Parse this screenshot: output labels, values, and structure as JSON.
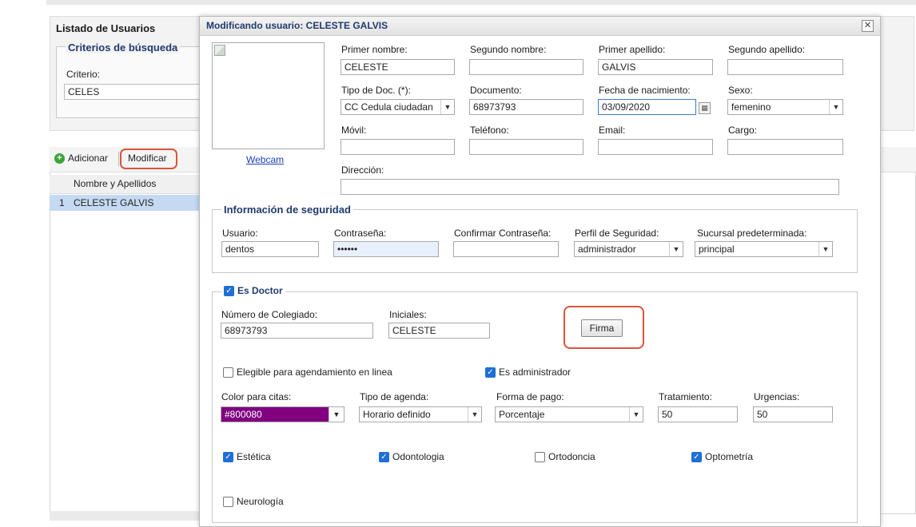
{
  "background": {
    "title": "Listado de Usuarios",
    "criteria_legend": "Criterios de búsqueda",
    "criteria_label": "Criterio:",
    "criteria_value": "CELES",
    "add_label": "Adicionar",
    "modify_label": "Modificar",
    "column_header": "Nombre y Apellidos",
    "rows": [
      {
        "num": "1",
        "name": "CELESTE GALVIS"
      }
    ]
  },
  "dialog": {
    "title": "Modificando usuario: CELESTE GALVIS",
    "close_icon": "close-icon",
    "webcam_link": "Webcam",
    "labels": {
      "primer_nombre": "Primer nombre:",
      "segundo_nombre": "Segundo nombre:",
      "primer_apellido": "Primer apellido:",
      "segundo_apellido": "Segundo apellido:",
      "tipo_doc": "Tipo de Doc. (*):",
      "documento": "Documento:",
      "fecha_nac": "Fecha de nacimiento:",
      "sexo": "Sexo:",
      "movil": "Móvil:",
      "telefono": "Teléfono:",
      "email": "Email:",
      "cargo": "Cargo:",
      "direccion": "Dirección:"
    },
    "values": {
      "primer_nombre": "CELESTE",
      "segundo_nombre": "",
      "primer_apellido": "GALVIS",
      "segundo_apellido": "",
      "tipo_doc": "CC Cedula ciudadan",
      "documento": "68973793",
      "fecha_nac": "03/09/2020",
      "sexo": "femenino",
      "movil": "",
      "telefono": "",
      "email": "",
      "cargo": "",
      "direccion": ""
    },
    "security": {
      "legend": "Información de seguridad",
      "usuario_label": "Usuario:",
      "usuario_value": "dentos",
      "password_label": "Contraseña:",
      "password_value": "••••••",
      "confirm_label": "Confirmar Contraseña:",
      "perfil_label": "Perfil de Seguridad:",
      "perfil_value": "administrador",
      "sucursal_label": "Sucursal predeterminada:",
      "sucursal_value": "principal"
    },
    "doctor": {
      "legend": "Es Doctor",
      "checked": true,
      "colegiado_label": "Número de Colegiado:",
      "colegiado_value": "68973793",
      "iniciales_label": "Iniciales:",
      "iniciales_value": "CELESTE",
      "firma_button": "Firma",
      "elegible_label": "Elegible para agendamiento en linea",
      "es_admin_label": "Es administrador",
      "color_label": "Color para citas:",
      "color_value": "#800080",
      "agenda_label": "Tipo de agenda:",
      "agenda_value": "Horario definido",
      "pago_label": "Forma de pago:",
      "pago_value": "Porcentaje",
      "tratamiento_label": "Tratamiento:",
      "tratamiento_value": "50",
      "urgencias_label": "Urgencias:",
      "urgencias_value": "50",
      "specialties": [
        {
          "label": "Estética",
          "checked": true
        },
        {
          "label": "Odontologia",
          "checked": true
        },
        {
          "label": "Ortodoncia",
          "checked": false
        },
        {
          "label": "Optometría",
          "checked": true
        },
        {
          "label": "Neurología",
          "checked": false
        }
      ]
    }
  },
  "colors": {
    "accent": "#203a6e",
    "highlight_ring": "#d9553d",
    "selected_row": "#c5daf2",
    "checkbox": "#1f6fd6"
  }
}
